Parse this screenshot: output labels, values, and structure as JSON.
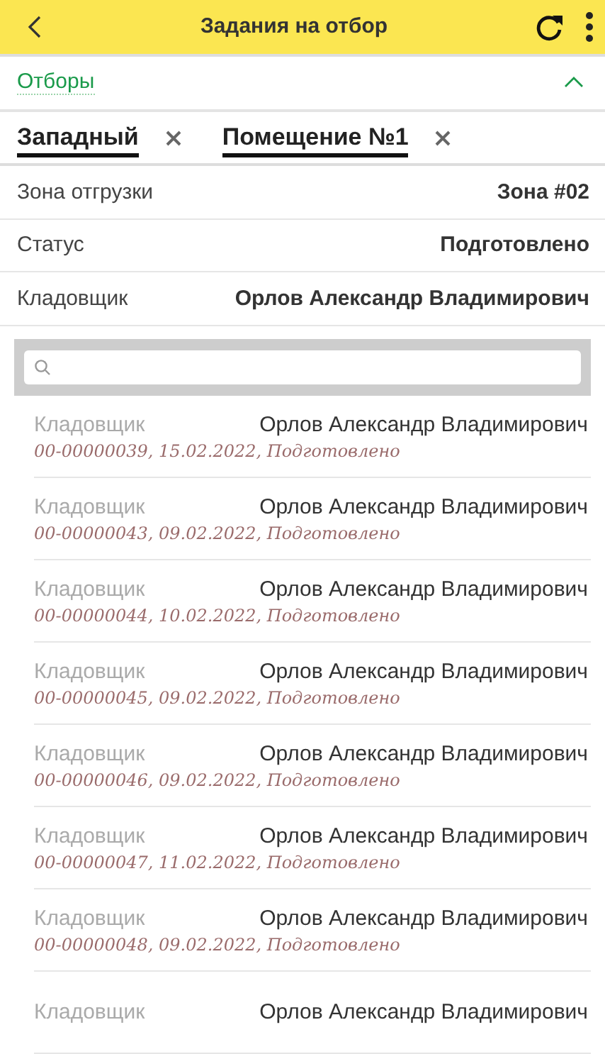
{
  "header": {
    "title": "Задания на отбор"
  },
  "filters": {
    "label": "Отборы",
    "expanded": true
  },
  "chips": [
    {
      "label": "Западный"
    },
    {
      "label": "Помещение №1"
    }
  ],
  "fields": [
    {
      "label": "Зона отгрузки",
      "value": "Зона #02"
    },
    {
      "label": "Статус",
      "value": "Подготовлено"
    },
    {
      "label": "Кладовщик",
      "value": "Орлов Александр Владимирович"
    }
  ],
  "items": [
    {
      "label": "Кладовщик",
      "name": "Орлов Александр Владимирович",
      "meta": "00-00000039, 15.02.2022, Подготовлено"
    },
    {
      "label": "Кладовщик",
      "name": "Орлов Александр Владимирович",
      "meta": "00-00000043, 09.02.2022, Подготовлено"
    },
    {
      "label": "Кладовщик",
      "name": "Орлов Александр Владимирович",
      "meta": "00-00000044, 10.02.2022, Подготовлено"
    },
    {
      "label": "Кладовщик",
      "name": "Орлов Александр Владимирович",
      "meta": "00-00000045, 09.02.2022, Подготовлено"
    },
    {
      "label": "Кладовщик",
      "name": "Орлов Александр Владимирович",
      "meta": "00-00000046, 09.02.2022, Подготовлено"
    },
    {
      "label": "Кладовщик",
      "name": "Орлов Александр Владимирович",
      "meta": "00-00000047, 11.02.2022, Подготовлено"
    },
    {
      "label": "Кладовщик",
      "name": "Орлов Александр Владимирович",
      "meta": "00-00000048, 09.02.2022, Подготовлено"
    },
    {
      "label": "Кладовщик",
      "name": "Орлов Александр Владимирович"
    }
  ]
}
